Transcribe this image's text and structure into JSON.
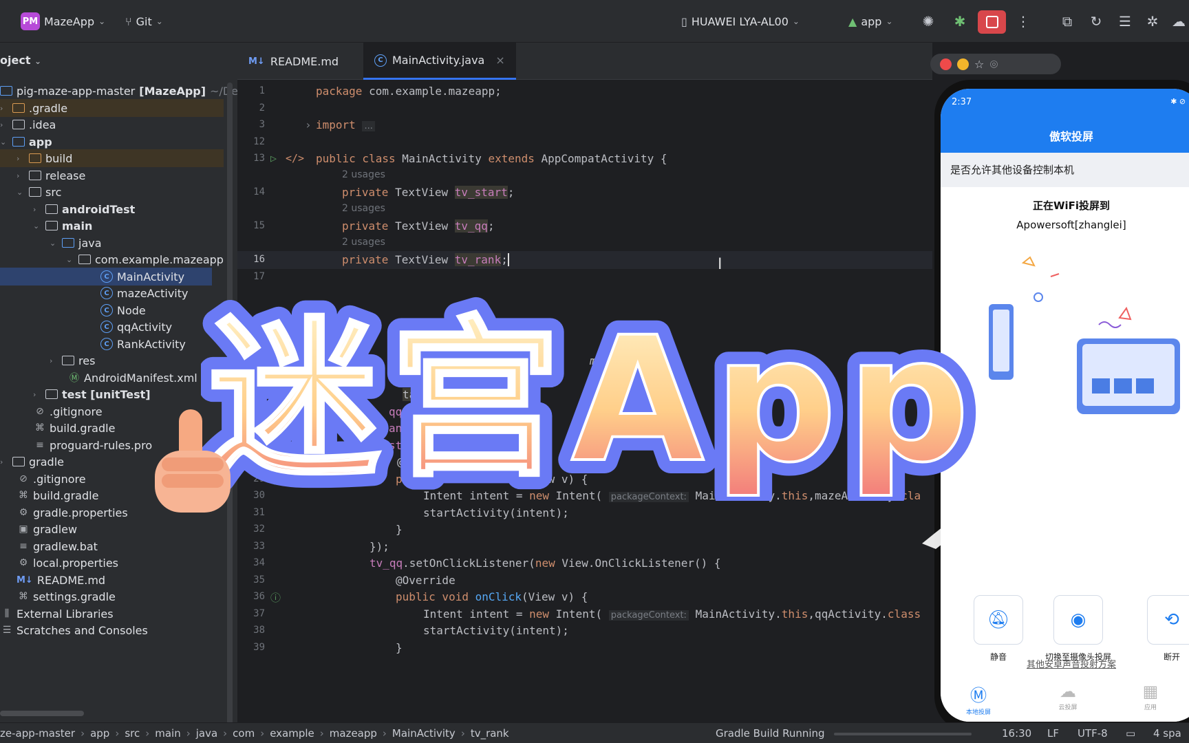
{
  "toolbar": {
    "project_badge": "PM",
    "project_name": "MazeApp",
    "vcs": "Git",
    "device": "HUAWEI LYA-AL00",
    "run_config": "app"
  },
  "project_panel": {
    "header": "oject",
    "items": [
      {
        "label": "pig-maze-app-master",
        "bold_suffix": "[MazeApp]",
        "path": "~/De"
      },
      {
        "label": ".gradle"
      },
      {
        "label": ".idea"
      },
      {
        "label": "app"
      },
      {
        "label": "build"
      },
      {
        "label": "release"
      },
      {
        "label": "src"
      },
      {
        "label": "androidTest"
      },
      {
        "label": "main"
      },
      {
        "label": "java"
      },
      {
        "label": "com.example.mazeapp"
      },
      {
        "label": "MainActivity"
      },
      {
        "label": "mazeActivity"
      },
      {
        "label": "Node"
      },
      {
        "label": "qqActivity"
      },
      {
        "label": "RankActivity"
      },
      {
        "label": "res"
      },
      {
        "label": "AndroidManifest.xml"
      },
      {
        "label": "test [unitTest]"
      },
      {
        "label": ".gitignore"
      },
      {
        "label": "build.gradle"
      },
      {
        "label": "proguard-rules.pro"
      },
      {
        "label": "gradle"
      },
      {
        "label": ".gitignore"
      },
      {
        "label": "build.gradle"
      },
      {
        "label": "gradle.properties"
      },
      {
        "label": "gradlew"
      },
      {
        "label": "gradlew.bat"
      },
      {
        "label": "local.properties"
      },
      {
        "label": "README.md"
      },
      {
        "label": "settings.gradle"
      },
      {
        "label": "External Libraries"
      },
      {
        "label": "Scratches and Consoles"
      }
    ]
  },
  "editor": {
    "tabs": [
      {
        "icon": "M↓",
        "label": "README.md"
      },
      {
        "icon": "C",
        "label": "MainActivity.java"
      }
    ],
    "lines": {
      "l1": {
        "n": "1",
        "t": "package com.example.mazeapp;"
      },
      "l2": {
        "n": "2"
      },
      "l3": {
        "n": "3",
        "t": "import ..."
      },
      "l12": {
        "n": "12"
      },
      "l13": {
        "n": "13",
        "t": "public class MainActivity extends AppCompatActivity {"
      },
      "u1": "2 usages",
      "l14": {
        "n": "14",
        "t": "private TextView tv_start;"
      },
      "u2": "2 usages",
      "l15": {
        "n": "15",
        "t": "private TextView tv_qq;"
      },
      "u3": "2 usages",
      "l16": {
        "n": "16",
        "t": "private TextView tv_rank;"
      },
      "l17": {
        "n": "17"
      },
      "l29": {
        "n": "29",
        "t": "public void onClick(View v) {"
      },
      "l30": {
        "n": "30",
        "t": "Intent intent = new Intent(",
        "hint": "packageContext:",
        "rest": "MainActivity.this,mazeActivity.cla"
      },
      "l31": {
        "n": "31",
        "t": "startActivity(intent);"
      },
      "l32": {
        "n": "32",
        "t": "}"
      },
      "l33": {
        "n": "33",
        "t": "});"
      },
      "l34": {
        "n": "34",
        "t": "tv_qq.setOnClickListener(new View.OnClickListener() {"
      },
      "l35": {
        "n": "35",
        "t": "@Override"
      },
      "l36": {
        "n": "36",
        "t": "public void onClick(View v) {"
      },
      "l37": {
        "n": "37",
        "t": "Intent intent = new Intent(",
        "hint": "packageContext:",
        "rest": "MainActivity.this,qqActivity.class"
      },
      "l38": {
        "n": "38",
        "t": "startActivity(intent);"
      },
      "l39": {
        "n": "39",
        "t": "}"
      },
      "frag1": "oid",
      "frag2": "ceState",
      "frag3": ".on",
      "frag4": "nte",
      "frag5": "main);",
      "frag6": "tart=",
      "frag7": "rt);",
      "frag8": "qq=fi",
      "frag9": "ank=",
      "frag10": ");",
      "frag11": "star",
      "frag12": "@Ove"
    }
  },
  "phone": {
    "time": "2:37",
    "title": "傲软投屏",
    "control_prompt": "是否允许其他设备控制本机",
    "casting": "正在WiFi投屏到",
    "target": "Apowersoft[zhanglei]",
    "buttons": [
      {
        "label": "静音",
        "icon": "mute-icon"
      },
      {
        "label": "切换至摄像头投屏",
        "icon": "camera-icon"
      },
      {
        "label": "断开",
        "icon": "disconnect-icon"
      }
    ],
    "other_link": "其他安卓声音投射方案",
    "nav": [
      {
        "label": "本地投屏"
      },
      {
        "label": "云投屏"
      },
      {
        "label": "应用"
      }
    ]
  },
  "statusbar": {
    "breadcrumb": [
      "ze-app-master",
      "app",
      "src",
      "main",
      "java",
      "com",
      "example",
      "mazeapp",
      "MainActivity",
      "tv_rank"
    ],
    "build_status": "Gradle Build Running",
    "time": "16:30",
    "line_sep": "LF",
    "encoding": "UTF-8",
    "indent": "4 spa"
  },
  "overlay": {
    "title": "迷宫App"
  },
  "colors": {
    "ide_bg": "#1e1f22",
    "panel_bg": "#2b2d30",
    "accent": "#3574f0",
    "phone_blue": "#1e7df0",
    "stop_red": "#d8474b"
  }
}
